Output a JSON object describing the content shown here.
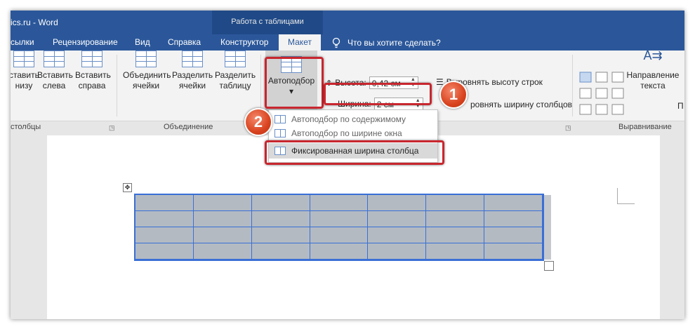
{
  "window": {
    "title": "ics.ru  -  Word",
    "contextual_title": "Работа с таблицами"
  },
  "tabs": [
    {
      "label": "сылки"
    },
    {
      "label": "Рецензирование"
    },
    {
      "label": "Вид"
    },
    {
      "label": "Справка"
    },
    {
      "label": "Конструктор"
    },
    {
      "label": "Макет",
      "active": true
    }
  ],
  "tell_me": {
    "placeholder": "Что вы хотите сделать?",
    "icon": "lightbulb-icon"
  },
  "ribbon": {
    "rows_cols": {
      "group_label": "столбцы",
      "buttons": [
        {
          "line1": "ставить",
          "line2": "низу"
        },
        {
          "line1": "Вставить",
          "line2": "слева"
        },
        {
          "line1": "Вставить",
          "line2": "справа"
        }
      ]
    },
    "merge": {
      "group_label": "Объединение",
      "buttons": [
        {
          "line1": "Объединить",
          "line2": "ячейки"
        },
        {
          "line1": "Разделить",
          "line2": "ячейки"
        },
        {
          "line1": "Разделить",
          "line2": "таблицу"
        }
      ]
    },
    "autofit": {
      "label": "Автоподбор",
      "arrow": "▾"
    },
    "cell_size": {
      "height_label": "Высота:",
      "height_value": "0,42 см",
      "width_label": "Ширина:",
      "width_value": "2 см",
      "distribute_rows": "Выровнять высоту строк",
      "distribute_cols_partial": "ровнять ширину столбцов"
    },
    "alignment": {
      "group_label": "Выравнивание",
      "direction_line1": "Направление",
      "direction_line2": "текста",
      "last_partial": "П"
    }
  },
  "autofit_menu": {
    "items": [
      {
        "label": "Автоподбор по содержимому"
      },
      {
        "label": "Автоподбор по ширине окна"
      },
      {
        "label": "Фиксированная ширина столбца",
        "selected": true
      }
    ]
  },
  "callouts": {
    "one": "1",
    "two": "2"
  },
  "colors": {
    "title_bar": "#2b579a",
    "callout": "#d9431f",
    "highlight_border": "#c8262e",
    "table_border": "#3a6fd6",
    "selection_fill": "#b3bac2"
  }
}
